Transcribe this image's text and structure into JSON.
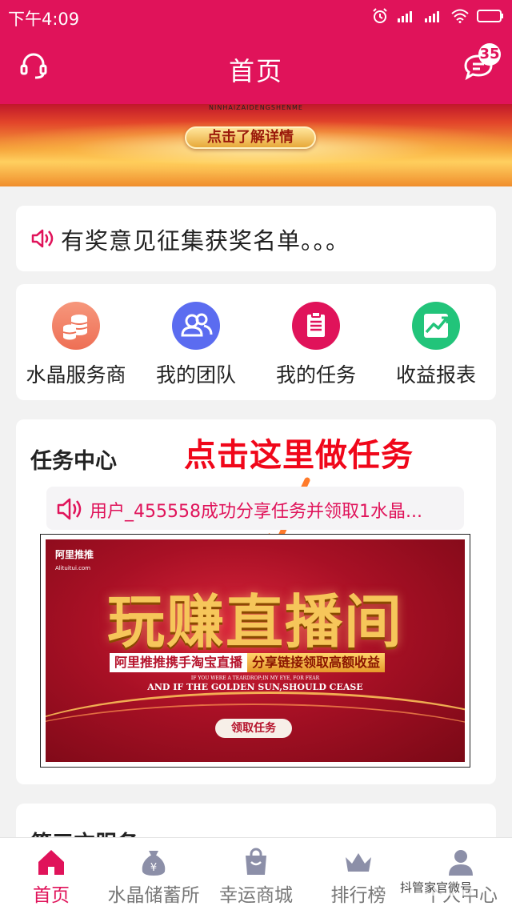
{
  "status_bar": {
    "time": "下午4:09"
  },
  "header": {
    "title": "首页",
    "message_badge": "35"
  },
  "banner": {
    "tiny_text": "NINHAIZAIDENGSHENME",
    "button_label": "点击了解详情"
  },
  "notice": {
    "text": "有奖意见征集获奖名单。。。"
  },
  "quick_menu": {
    "items": [
      {
        "label": "水晶服务商",
        "icon": "coins-icon",
        "color": "#f07a62"
      },
      {
        "label": "我的团队",
        "icon": "team-icon",
        "color": "#5b6cf0"
      },
      {
        "label": "我的任务",
        "icon": "clipboard-icon",
        "color": "#e0135a"
      },
      {
        "label": "收益报表",
        "icon": "chart-icon",
        "color": "#22c47a"
      }
    ]
  },
  "task_center": {
    "title": "任务中心",
    "hint": "点击这里做任务",
    "ticker": "用户_455558成功分享任务并领取1水晶...",
    "promo": {
      "logo_name": "阿里推推",
      "logo_url": "Alituitui.com",
      "headline": "玩赚直播间",
      "sub_a": "阿里推推携手淘宝直播",
      "sub_b": "分享链接领取高额收益",
      "en_small": "IF YOU WERE A TEARDROP;IN MY EYE, FOR FEAR",
      "en_big": "AND IF THE GOLDEN SUN,SHOULD CEASE",
      "cta": "领取任务"
    }
  },
  "service": {
    "title": "第三方服务"
  },
  "bottom_nav": {
    "items": [
      {
        "label": "首页",
        "icon": "home-icon",
        "active": true
      },
      {
        "label": "水晶储蓄所",
        "icon": "money-bag-icon",
        "active": false
      },
      {
        "label": "幸运商城",
        "icon": "shopping-bag-icon",
        "active": false
      },
      {
        "label": "排行榜",
        "icon": "crown-icon",
        "active": false
      },
      {
        "label": "个人中心",
        "icon": "user-icon",
        "active": false
      }
    ]
  },
  "watermark": "抖管家官微号",
  "colors": {
    "brand": "#e0135a",
    "hint_red": "#f0071a"
  }
}
